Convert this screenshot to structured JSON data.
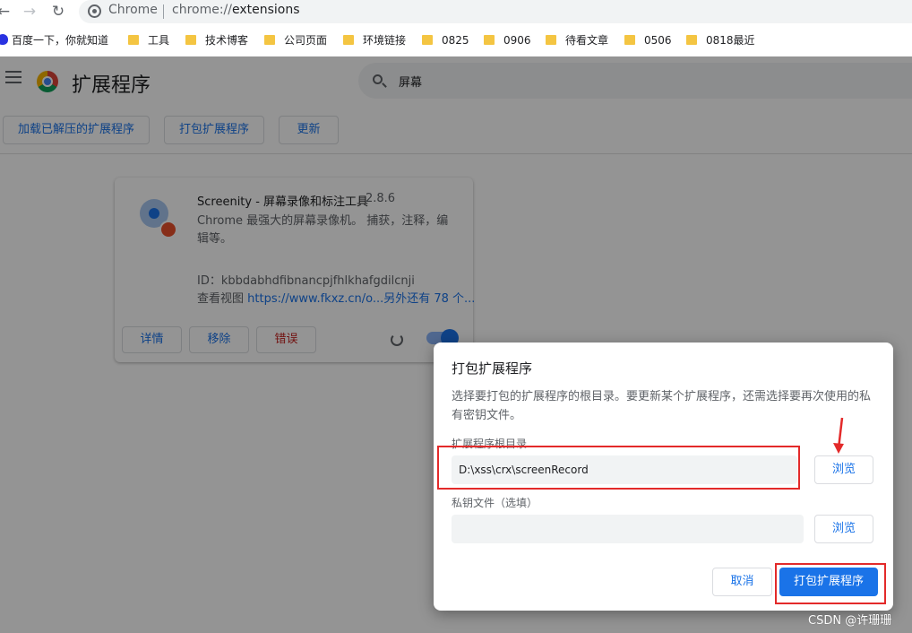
{
  "browser": {
    "site_name": "Chrome",
    "url_scheme": "chrome://",
    "url_host": "extensions"
  },
  "bookmarks": [
    {
      "label": "百度一下，你就知道",
      "icon": "baidu-paw-icon"
    },
    {
      "label": "工具",
      "icon": "folder-icon"
    },
    {
      "label": "技术博客",
      "icon": "folder-icon"
    },
    {
      "label": "公司页面",
      "icon": "folder-icon"
    },
    {
      "label": "环境链接",
      "icon": "folder-icon"
    },
    {
      "label": "0825",
      "icon": "folder-icon"
    },
    {
      "label": "0906",
      "icon": "folder-icon"
    },
    {
      "label": "待看文章",
      "icon": "folder-icon"
    },
    {
      "label": "0506",
      "icon": "folder-icon"
    },
    {
      "label": "0818最近",
      "icon": "folder-icon"
    }
  ],
  "header": {
    "title": "扩展程序",
    "search_value": "屏幕"
  },
  "actions": {
    "load_unpacked": "加载已解压的扩展程序",
    "pack": "打包扩展程序",
    "update": "更新"
  },
  "extension": {
    "name": "Screenity - 屏幕录像和标注工具",
    "version": "2.8.6",
    "description": "Chrome 最强大的屏幕录像机。 捕获，注释，编辑等。",
    "id_label": "ID：kbbdabhdfibnancpjfhlkhafgdilcnji",
    "views_label": "查看视图",
    "views_link": "https://www.fkxz.cn/o...",
    "views_more": "另外还有 78 个...",
    "details_label": "详情",
    "remove_label": "移除",
    "errors_label": "错误",
    "enabled": true
  },
  "dialog": {
    "title": "打包扩展程序",
    "description": "选择要打包的扩展程序的根目录。要更新某个扩展程序，还需选择要再次使用的私有密钥文件。",
    "root_label": "扩展程序根目录",
    "root_value": "D:\\xss\\crx\\screenRecord",
    "key_label": "私钥文件（选填）",
    "key_value": "",
    "browse_label": "浏览",
    "cancel_label": "取消",
    "pack_label": "打包扩展程序"
  },
  "colors": {
    "accent": "#1a73e8",
    "annotation": "#e32a2a",
    "error_text": "#c5221f"
  },
  "watermark": "CSDN @许珊珊"
}
